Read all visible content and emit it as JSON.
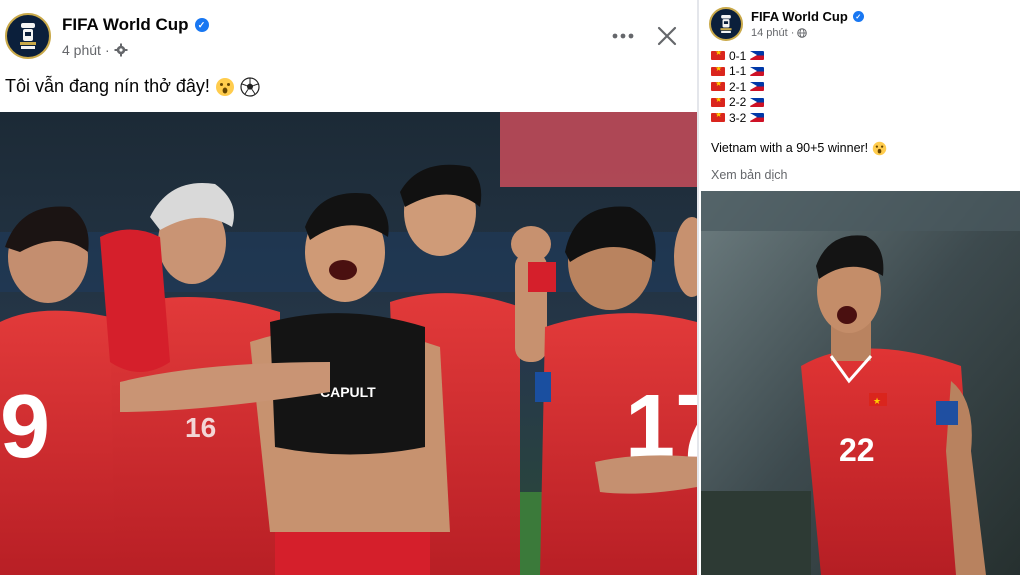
{
  "left_post": {
    "page_name": "FIFA World Cup",
    "timestamp": "4 phút",
    "privacy_icon": "gear-icon",
    "text": "Tôi vẫn đang nín thở đây!",
    "emojis": [
      "astonished-face-emoji",
      "soccer-ball-emoji"
    ],
    "more_icon": "more-horizontal-icon",
    "close_icon": "close-icon",
    "photo": {
      "description_icon": "celebration-photo",
      "jersey_numbers": [
        "9",
        "16",
        "17"
      ],
      "vest_brand": "CAPULT"
    }
  },
  "right_post": {
    "page_name": "FIFA World Cup",
    "timestamp": "14 phút",
    "privacy_icon": "globe-icon",
    "scores": [
      {
        "home_flag": "vietnam-flag",
        "score": "0-1",
        "away_flag": "philippines-flag"
      },
      {
        "home_flag": "vietnam-flag",
        "score": "1-1",
        "away_flag": "philippines-flag"
      },
      {
        "home_flag": "vietnam-flag",
        "score": "2-1",
        "away_flag": "philippines-flag"
      },
      {
        "home_flag": "vietnam-flag",
        "score": "2-2",
        "away_flag": "philippines-flag"
      },
      {
        "home_flag": "vietnam-flag",
        "score": "3-2",
        "away_flag": "philippines-flag"
      }
    ],
    "caption": "Vietnam with a 90+5 winner!",
    "caption_emoji": "astonished-face-emoji",
    "translate_link": "Xem bản dịch",
    "photo": {
      "jersey_number": "22"
    }
  },
  "colors": {
    "verified_blue": "#1877f2",
    "secondary_text": "#65676b",
    "jersey_red": "#d42a2a",
    "vietnam_red": "#da251d",
    "vietnam_yellow": "#ffcd00"
  }
}
